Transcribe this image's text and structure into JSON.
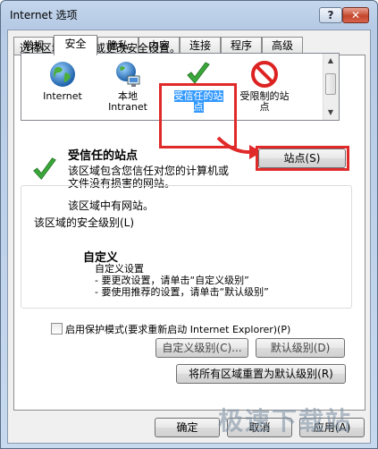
{
  "window": {
    "title": "Internet 选项",
    "help_label": "?",
    "close_label": "✕"
  },
  "tabs": [
    {
      "label": "常规"
    },
    {
      "label": "安全"
    },
    {
      "label": "隐私"
    },
    {
      "label": "内容"
    },
    {
      "label": "连接"
    },
    {
      "label": "程序"
    },
    {
      "label": "高级"
    }
  ],
  "active_tab": "安全",
  "security": {
    "zone_prompt": "选择区域以查看或更改安全设置。",
    "zones": [
      {
        "line1": "Internet",
        "line2": "",
        "icon": "globe-icon"
      },
      {
        "line1": "本地",
        "line2": "Intranet",
        "icon": "network-globe-icon"
      },
      {
        "line1": "受信任的站",
        "line2": "点",
        "icon": "green-check-icon"
      },
      {
        "line1": "受限制的站",
        "line2": "点",
        "icon": "red-no-icon"
      }
    ],
    "selected_zone": "受信任的站点",
    "zone_title": "受信任的站点",
    "zone_desc_1": "该区域包含您信任对您的计算机或",
    "zone_desc_2": "文件没有损害的网站。",
    "zone_has_sites": "该区域中有网站。",
    "sites_button": "站点(S)",
    "level_group_title": "该区域的安全级别(L)",
    "level_name": "自定义",
    "level_line1": "自定义设置",
    "level_line2": "- 要更改设置，请单击“自定义级别”",
    "level_line3": "- 要使用推荐的设置，请单击“默认级别”",
    "protected_mode_label": "启用保护模式(要求重新启动 Internet Explorer)(P)",
    "protected_mode_checked": false,
    "custom_level_button": "自定义级别(C)...",
    "default_level_button": "默认级别(D)",
    "reset_all_button": "将所有区域重置为默认级别(R)"
  },
  "footer": {
    "ok_button": "确定",
    "cancel_button": "取消",
    "apply_button": "应用(A)"
  },
  "watermark": "极速下载站",
  "colors": {
    "selection": "#3399ff",
    "highlight_red": "#e02a2a",
    "check_green": "#3aa83a"
  }
}
